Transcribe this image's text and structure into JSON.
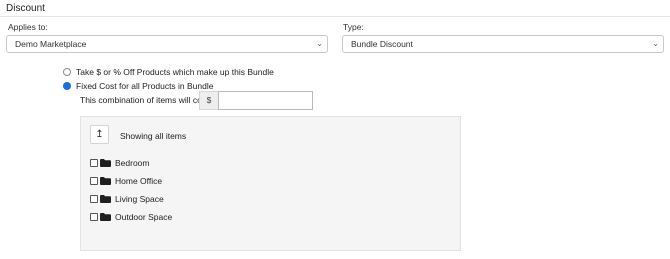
{
  "section": {
    "title": "Discount"
  },
  "applies_to": {
    "label": "Applies to:",
    "value": "Demo Marketplace"
  },
  "type": {
    "label": "Type:",
    "value": "Bundle Discount"
  },
  "options": [
    {
      "label": "Take $ or % Off Products which make up this Bundle",
      "checked": false
    },
    {
      "label": "Fixed Cost for all Products in Bundle",
      "checked": true
    }
  ],
  "cost": {
    "label": "This combination of items will cost",
    "currency": "$",
    "value": ""
  },
  "browser": {
    "up_icon": "↥",
    "status": "Showing all items",
    "items": [
      {
        "label": "Bedroom",
        "checked": false
      },
      {
        "label": "Home Office",
        "checked": false
      },
      {
        "label": "Living Space",
        "checked": false
      },
      {
        "label": "Outdoor Space",
        "checked": false
      }
    ]
  },
  "icons": {
    "select_chevron": "⌄",
    "folder": "folder-icon"
  },
  "colors": {
    "radio_selected": "#1a6fd8",
    "panel_background": "#f5f5f5"
  }
}
